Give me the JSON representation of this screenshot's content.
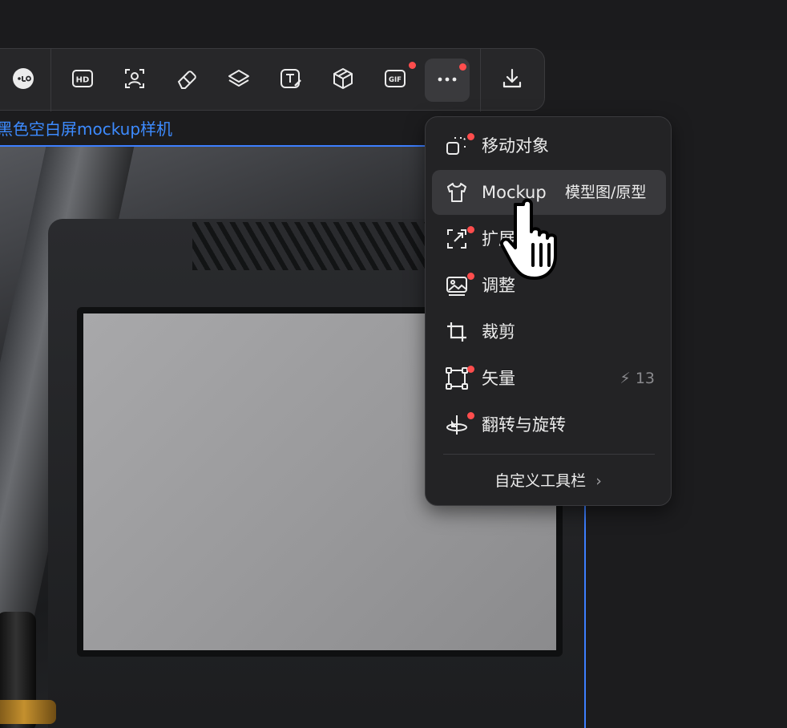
{
  "toolbar": {
    "items": [
      {
        "icon": "face-swap-icon",
        "active": false,
        "dot": false
      },
      {
        "icon": "hd-icon",
        "label": "HD",
        "active": false,
        "dot": false
      },
      {
        "icon": "portrait-select-icon",
        "active": false,
        "dot": false
      },
      {
        "icon": "eraser-icon",
        "active": false,
        "dot": false
      },
      {
        "icon": "layers-icon",
        "active": false,
        "dot": false
      },
      {
        "icon": "text-edit-icon",
        "active": false,
        "dot": false
      },
      {
        "icon": "cube-icon",
        "active": false,
        "dot": false
      },
      {
        "icon": "gif-icon",
        "label": "GIF",
        "active": false,
        "dot": true
      },
      {
        "icon": "more-icon",
        "active": true,
        "dot": true
      },
      {
        "icon": "download-icon",
        "active": false,
        "dot": false
      }
    ]
  },
  "layer": {
    "label": "黑色空白屏mockup样机"
  },
  "menu": {
    "items": [
      {
        "icon": "move-object-icon",
        "label": "移动对象",
        "dot": true
      },
      {
        "icon": "tshirt-icon",
        "label": "Mockup",
        "label2": "模型图/原型",
        "dot": false,
        "hover": true
      },
      {
        "icon": "expand-icon",
        "label": "扩展",
        "dot": true
      },
      {
        "icon": "adjust-icon",
        "label": "调整",
        "dot": true
      },
      {
        "icon": "crop-icon",
        "label": "裁剪",
        "dot": false
      },
      {
        "icon": "vector-icon",
        "label": "矢量",
        "badge": "13",
        "dot": true
      },
      {
        "icon": "flip-rotate-icon",
        "label": "翻转与旋转",
        "dot": true
      }
    ],
    "footer": "自定义工具栏",
    "footer_chevron": "›"
  },
  "colors": {
    "accent_blue": "#3d7fff",
    "notification_red": "#ff4d4d",
    "menu_bg": "#232325",
    "toolbar_bg": "#272729"
  }
}
